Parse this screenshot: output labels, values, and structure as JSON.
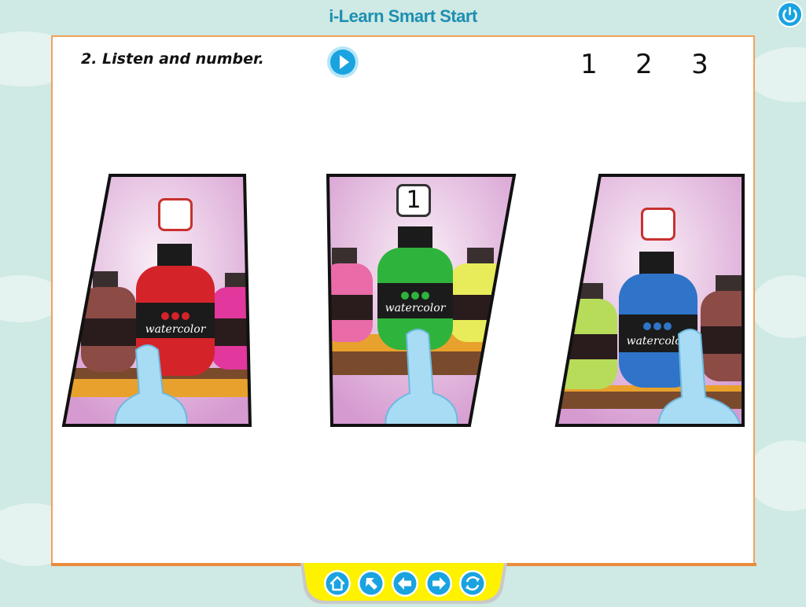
{
  "app": {
    "title": "i-Learn Smart Start"
  },
  "exercise": {
    "instruction": "2. Listen and number.",
    "choices": [
      "1",
      "2",
      "3"
    ]
  },
  "cards": [
    {
      "id": "card-red",
      "answer": "",
      "bottle_color": "#d4242a",
      "bottle_label": "watercolor",
      "side_left_color": "#8c4b45",
      "side_right_color": "#e2379c"
    },
    {
      "id": "card-green",
      "answer": "1",
      "bottle_color": "#2eb43c",
      "bottle_label": "watercolor",
      "side_left_color": "#e96ba8",
      "side_right_color": "#e8ec5a"
    },
    {
      "id": "card-blue",
      "answer": "",
      "bottle_color": "#2f74c8",
      "bottle_label": "watercolor",
      "side_left_color": "#b6dc5a",
      "side_right_color": "#8c4b45"
    }
  ],
  "colors": {
    "panel_border": "#f0a259",
    "title": "#1c8fb2",
    "accent_blue": "#1aa3e1",
    "dock_yellow": "#fff200"
  },
  "nav": [
    {
      "icon": "home-icon"
    },
    {
      "icon": "up-left-arrow-icon"
    },
    {
      "icon": "back-arrow-icon"
    },
    {
      "icon": "next-arrow-icon"
    },
    {
      "icon": "refresh-icon"
    }
  ]
}
